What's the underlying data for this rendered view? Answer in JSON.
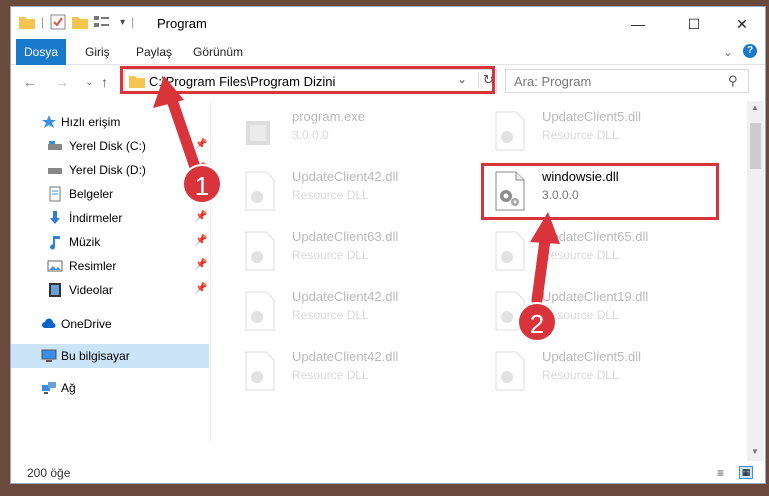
{
  "window": {
    "title": "Program"
  },
  "ribbon": {
    "tabs": [
      "Dosya",
      "Giriş",
      "Paylaş",
      "Görünüm"
    ]
  },
  "address": {
    "path": "C:\\Program Files\\Program Dizini"
  },
  "search": {
    "placeholder": "Ara: Program"
  },
  "sidebar": {
    "items": [
      {
        "label": "Hızlı erişim",
        "icon": "star-icon"
      },
      {
        "label": "Yerel Disk (C:)",
        "icon": "drive-icon",
        "pinned": true
      },
      {
        "label": "Yerel Disk (D:)",
        "icon": "drive-icon",
        "pinned": true
      },
      {
        "label": "Belgeler",
        "icon": "documents-icon",
        "pinned": true
      },
      {
        "label": "İndirmeler",
        "icon": "download-icon",
        "pinned": true
      },
      {
        "label": "Müzik",
        "icon": "music-icon",
        "pinned": true
      },
      {
        "label": "Resimler",
        "icon": "pictures-icon",
        "pinned": true
      },
      {
        "label": "Videolar",
        "icon": "video-icon",
        "pinned": true
      },
      {
        "label": "OneDrive",
        "icon": "cloud-icon"
      },
      {
        "label": "Bu bilgisayar",
        "icon": "computer-icon",
        "selected": true
      },
      {
        "label": "Ağ",
        "icon": "network-icon"
      }
    ]
  },
  "files": [
    {
      "name": "program.exe",
      "sub": "3.0.0.0",
      "type": "exe"
    },
    {
      "name": "UpdateClient5.dll",
      "sub": "Resource DLL",
      "type": "dll"
    },
    {
      "name": "UpdateClient42.dll",
      "sub": "Resource DLL",
      "type": "dll"
    },
    {
      "name": "windowsie.dll",
      "sub": "3.0.0.0",
      "type": "dll",
      "highlight": true
    },
    {
      "name": "UpdateClient63.dll",
      "sub": "Resource DLL",
      "type": "dll"
    },
    {
      "name": "UpdateClient65.dll",
      "sub": "Resource DLL",
      "type": "dll"
    },
    {
      "name": "UpdateClient42.dll",
      "sub": "Resource DLL",
      "type": "dll"
    },
    {
      "name": "UpdateClient19.dll",
      "sub": "Resource DLL",
      "type": "dll"
    },
    {
      "name": "UpdateClient42.dll",
      "sub": "Resource DLL",
      "type": "dll"
    },
    {
      "name": "UpdateClient5.dll",
      "sub": "Resource DLL",
      "type": "dll"
    }
  ],
  "status": {
    "count": "200 öğe"
  },
  "annotations": {
    "badge1": "1",
    "badge2": "2",
    "color": "#d9343b"
  }
}
